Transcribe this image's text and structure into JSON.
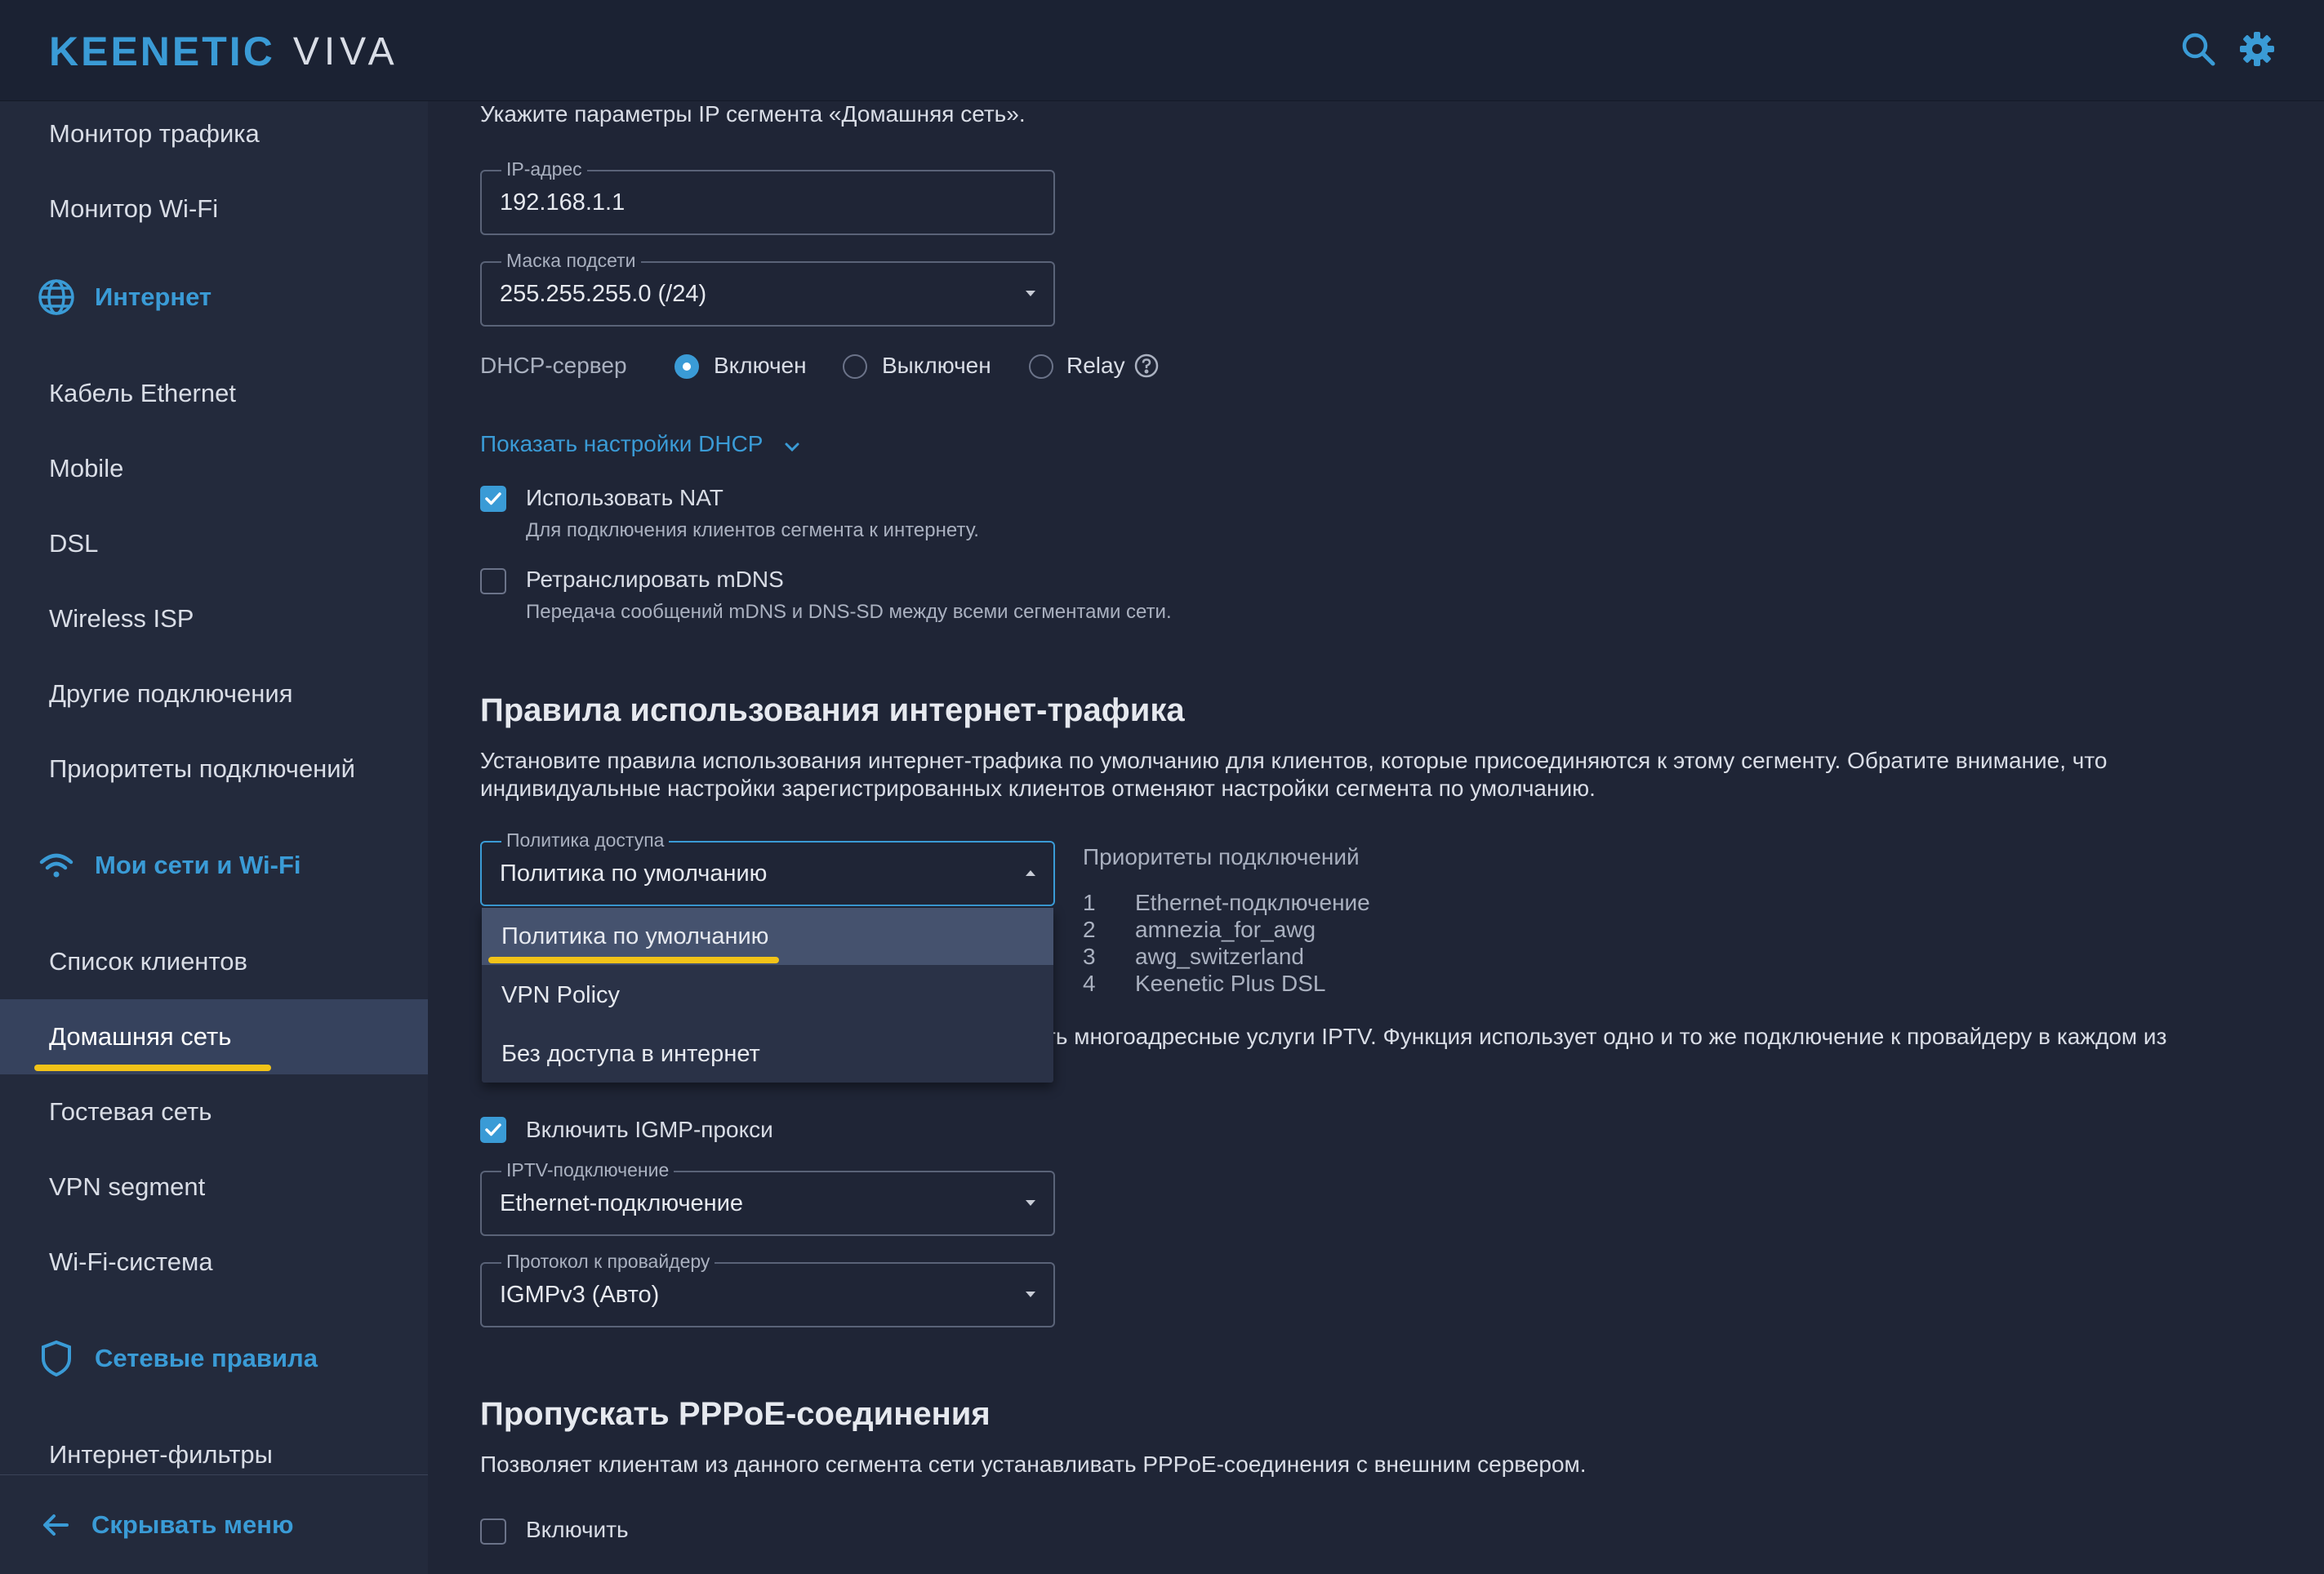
{
  "header": {
    "brand": "KEENETIC",
    "model": "VIVA",
    "search_icon": "search-icon",
    "settings_icon": "gear-icon",
    "accent_color": "#3a9bd6"
  },
  "sidebar": {
    "items_top": [
      "Монитор трафика",
      "Монитор Wi-Fi"
    ],
    "section_internet": "Интернет",
    "internet_items": [
      "Кабель Ethernet",
      "Mobile",
      "DSL",
      "Wireless ISP",
      "Другие подключения",
      "Приоритеты подключений"
    ],
    "section_networks": "Мои сети и Wi-Fi",
    "network_items": [
      "Список клиентов",
      "Домашняя сеть",
      "Гостевая сеть",
      "VPN segment",
      "Wi-Fi-система"
    ],
    "active_item": "Домашняя сеть",
    "section_rules": "Сетевые правила",
    "rules_items": [
      "Интернет-фильтры"
    ],
    "footer": "Скрывать меню"
  },
  "ip_segment": {
    "intro": "Укажите параметры IP сегмента «Домашняя сеть».",
    "ip_label": "IP-адрес",
    "ip_value": "192.168.1.1",
    "mask_label": "Маска подсети",
    "mask_value": "255.255.255.0 (/24)",
    "dhcp_label": "DHCP-сервер",
    "dhcp_options": [
      "Включен",
      "Выключен",
      "Relay"
    ],
    "dhcp_selected": "Включен",
    "show_dhcp_link": "Показать настройки DHCP",
    "nat_label": "Использовать NAT",
    "nat_desc": "Для подключения клиентов сегмента к интернету.",
    "nat_checked": true,
    "mdns_label": "Ретранслировать mDNS",
    "mdns_desc": "Передача сообщений mDNS и DNS-SD между всеми сегментами сети.",
    "mdns_checked": false
  },
  "traffic_rules": {
    "title": "Правила использования интернет-трафика",
    "desc_line1": "Установите правила использования интернет-трафика по умолчанию для клиентов, которые присоединяются к этому сегменту. Обратите внимание, что",
    "desc_line2": "индивидуальные настройки зарегистрированных клиентов отменяют настройки сегмента по умолчанию.",
    "policy_label": "Политика доступа",
    "policy_value": "Политика по умолчанию",
    "policy_options": [
      "Политика по умолчанию",
      "VPN Policy",
      "Без доступа в интернет"
    ],
    "priorities_title": "Приоритеты подключений",
    "priorities": [
      {
        "n": "1",
        "name": "Ethernet-подключение"
      },
      {
        "n": "2",
        "name": "amnezia_for_awg"
      },
      {
        "n": "3",
        "name": "awg_switzerland"
      },
      {
        "n": "4",
        "name": "Keenetic Plus DSL"
      }
    ]
  },
  "iptv": {
    "partial_text": "ть многоадресные услуги IPTV. Функция использует одно и то же подключение к провайдеру в каждом из",
    "igmp_label": "Включить IGMP-прокси",
    "igmp_checked": true,
    "iptv_conn_label": "IPTV-подключение",
    "iptv_conn_value": "Ethernet-подключение",
    "protocol_label": "Протокол к провайдеру",
    "protocol_value": "IGMPv3 (Авто)"
  },
  "pppoe": {
    "title": "Пропускать PPPoE-соединения",
    "desc": "Позволяет клиентам из данного сегмента сети устанавливать PPPoE-соединения с внешним сервером.",
    "enable_label": "Включить",
    "enable_checked": false
  }
}
